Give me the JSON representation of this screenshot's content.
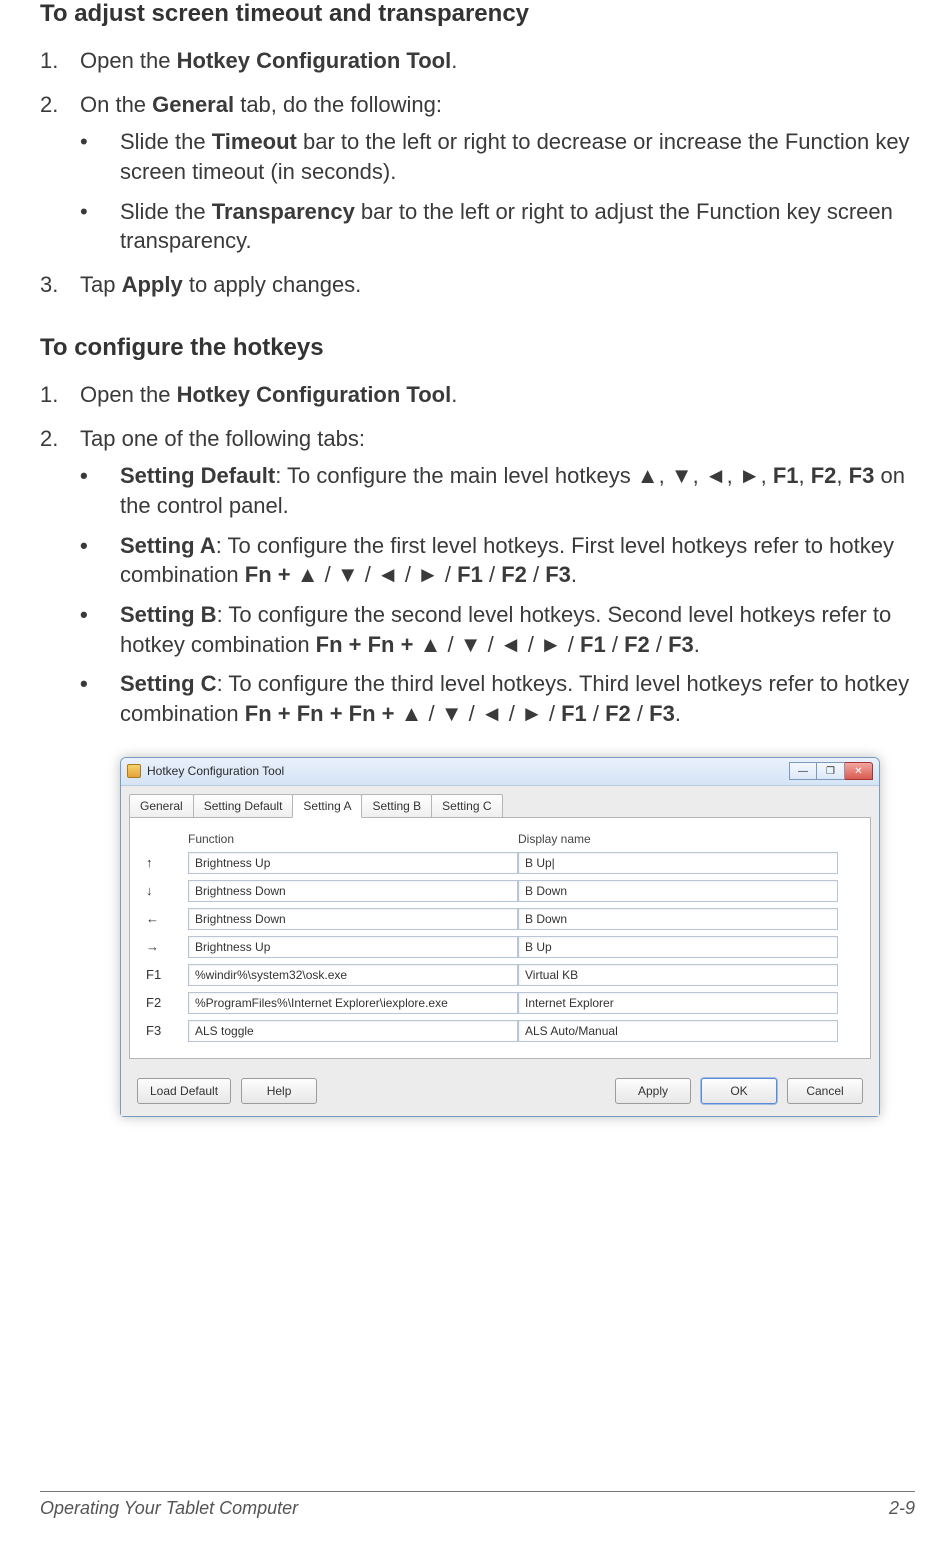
{
  "section1": {
    "title": "To adjust screen timeout and transparency",
    "steps": {
      "s1": {
        "num": "1.",
        "pre": "Open the ",
        "bold": "Hotkey Configuration Tool",
        "post": "."
      },
      "s2": {
        "num": "2.",
        "pre": "On the ",
        "bold": "General",
        "post": " tab, do the following:",
        "bullets": {
          "b1": {
            "bullet": "•",
            "pre": "Slide the ",
            "bold": "Timeout",
            "post": " bar to the left or right to decrease or increase the Function key screen timeout (in seconds)."
          },
          "b2": {
            "bullet": "•",
            "pre": "Slide the ",
            "bold": "Transparency",
            "post": " bar to the left or right to adjust the Function key screen transparency."
          }
        }
      },
      "s3": {
        "num": "3.",
        "pre": "Tap ",
        "bold": "Apply",
        "post": " to apply changes."
      }
    }
  },
  "section2": {
    "title": "To configure the hotkeys",
    "steps": {
      "s1": {
        "num": "1.",
        "pre": "Open the ",
        "bold": "Hotkey Configuration Tool",
        "post": "."
      },
      "s2": {
        "num": "2.",
        "text": "Tap one of the following tabs:",
        "bullets": {
          "b1": {
            "bullet": "•",
            "bold1": "Setting Default",
            "mid": ": To configure the main level hotkeys ▲, ▼, ◄, ►, ",
            "bold2": "F1",
            "sep1": ", ",
            "bold3": "F2",
            "sep2": ", ",
            "bold4": "F3",
            "post": " on the control panel."
          },
          "b2": {
            "bullet": "•",
            "bold1": "Setting A",
            "mid": ": To configure the first level hotkeys. First level hotkeys refer to hotkey combination ",
            "combo_bold1": "Fn +",
            "combo_mid": " ▲ / ▼ / ◄ / ► / ",
            "combo_bold2": "F1",
            "slash1": " / ",
            "combo_bold3": "F2",
            "slash2": " / ",
            "combo_bold4": "F3",
            "post": "."
          },
          "b3": {
            "bullet": "•",
            "bold1": "Setting B",
            "mid": ": To configure the second level hotkeys. Second level hotkeys refer to hotkey combination ",
            "combo_bold1": "Fn + Fn +",
            "combo_mid": " ▲ / ▼ / ◄ / ► / ",
            "combo_bold2": "F1",
            "slash1": " / ",
            "combo_bold3": "F2",
            "slash2": " / ",
            "combo_bold4": "F3",
            "post": "."
          },
          "b4": {
            "bullet": "•",
            "bold1": "Setting C",
            "mid": ": To configure the third level hotkeys. Third level hotkeys refer to hotkey combination ",
            "combo_bold1": "Fn + Fn + Fn +",
            "combo_mid": " ▲ / ▼ / ◄ / ► / ",
            "combo_bold2": "F1",
            "slash1": " / ",
            "combo_bold3": "F2",
            "slash2": " / ",
            "combo_bold4": "F3",
            "post": "."
          }
        }
      }
    }
  },
  "app": {
    "title": "Hotkey Configuration Tool",
    "tabs": {
      "t1": "General",
      "t2": "Setting Default",
      "t3": "Setting A",
      "t4": "Setting B",
      "t5": "Setting C"
    },
    "headers": {
      "func": "Function",
      "disp": "Display name"
    },
    "rows": {
      "r1": {
        "key": "↑",
        "func": "Brightness Up",
        "disp": "B Up|"
      },
      "r2": {
        "key": "↓",
        "func": "Brightness Down",
        "disp": "B Down"
      },
      "r3": {
        "key": "←",
        "func": "Brightness Down",
        "disp": "B Down"
      },
      "r4": {
        "key": "→",
        "func": "Brightness Up",
        "disp": "B Up"
      },
      "r5": {
        "key": "F1",
        "func": "%windir%\\system32\\osk.exe",
        "disp": "Virtual KB"
      },
      "r6": {
        "key": "F2",
        "func": "%ProgramFiles%\\Internet Explorer\\iexplore.exe",
        "disp": "Internet Explorer"
      },
      "r7": {
        "key": "F3",
        "func": "ALS toggle",
        "disp": "ALS Auto/Manual"
      }
    },
    "buttons": {
      "load": "Load Default",
      "help": "Help",
      "apply": "Apply",
      "ok": "OK",
      "cancel": "Cancel"
    },
    "winbtns": {
      "min": "—",
      "max": "❐",
      "close": "✕"
    }
  },
  "footer": {
    "left": "Operating Your Tablet Computer",
    "right": "2-9"
  }
}
